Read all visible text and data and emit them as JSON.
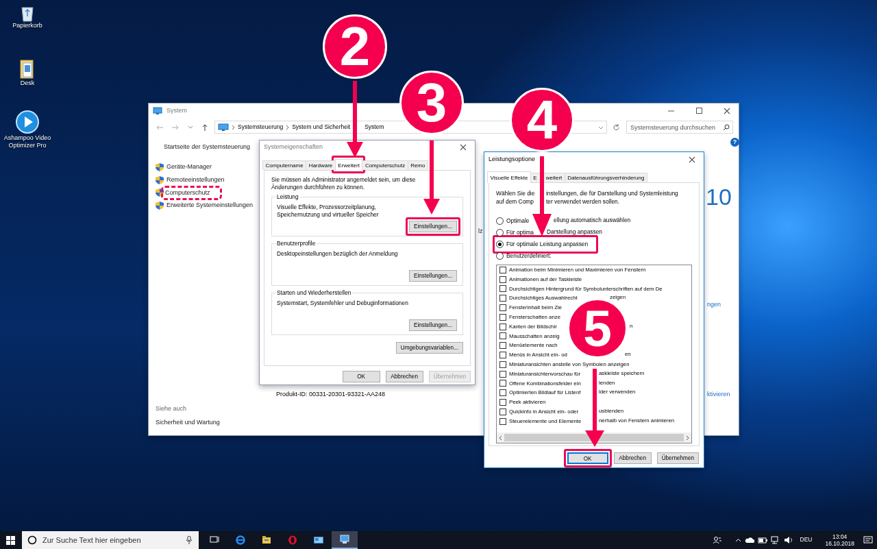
{
  "desktop_icons": [
    {
      "kind": "recycle-bin",
      "label": "Papierkorb"
    },
    {
      "kind": "folder",
      "label": "Desk"
    },
    {
      "kind": "player",
      "label": "Ashampoo Video Optimizer Pro"
    }
  ],
  "system_window": {
    "title": "System",
    "breadcrumb": [
      "Systemsteuerung",
      "System und Sicherheit",
      "System"
    ],
    "search": {
      "placeholder": "Systemsteuerung durchsuchen"
    },
    "help": "?",
    "home_link": "Startseite der Systemsteuerung",
    "links": [
      {
        "label": "Geräte-Manager",
        "highlighted": false
      },
      {
        "label": "Remoteeinstellungen",
        "highlighted": false
      },
      {
        "label": "Computerschutz",
        "highlighted": true,
        "dashed": true
      },
      {
        "label": "Erweiterte Systemeinstellungen",
        "highlighted": false
      }
    ],
    "see_also": {
      "title": "Siehe auch",
      "links": [
        "Sicherheit und Wartung"
      ]
    },
    "product_id": "Produkt-ID: 00331-20301-93321-AA248",
    "fragments": [
      "lz",
      "10",
      "ngen",
      "ktivieren"
    ]
  },
  "system_properties": {
    "title": "Systemeigenschaften",
    "tabs": [
      {
        "label": "Computername",
        "selected": false,
        "highlighted": false
      },
      {
        "label": "Hardware",
        "selected": false,
        "highlighted": false
      },
      {
        "label": "Erweitert",
        "selected": true,
        "highlighted": true
      },
      {
        "label": "Computerschutz",
        "selected": false,
        "highlighted": false
      },
      {
        "label": "Remo",
        "selected": false,
        "highlighted": false
      }
    ],
    "note": "Sie müssen als Administrator angemeldet sein, um diese Änderungen durchführen zu können.",
    "groups": [
      {
        "title": "Leistung",
        "text": "Visuelle Effekte, Prozessorzeitplanung, Speichernutzung und virtueller Speicher",
        "button": "Einstellungen...",
        "highlighted": true
      },
      {
        "title": "Benutzerprofile",
        "text": "Desktopeinstellungen bezüglich der Anmeldung",
        "button": "Einstellungen...",
        "highlighted": false
      },
      {
        "title": "Starten und Wiederherstellen",
        "text": "Systemstart, Systemfehler und Debuginformationen",
        "button": "Einstellungen...",
        "highlighted": false
      }
    ],
    "env_button": "Umgebungsvariablen...",
    "buttons": [
      {
        "label": "OK",
        "disabled": false
      },
      {
        "label": "Abbrechen",
        "disabled": false
      },
      {
        "label": "Übernehmen",
        "disabled": true
      }
    ]
  },
  "performance_options": {
    "title": "Leistungsoptione",
    "tabs": [
      {
        "label": [
          "Visuelle Effekte"
        ],
        "selected": true
      },
      {
        "label": [
          "E",
          "weitert"
        ],
        "selected": false
      },
      {
        "label": [
          "Datenausführungsverhinderung"
        ],
        "selected": false
      }
    ],
    "intro_lines": [
      [
        "Wählen Sie die",
        "instellungen, die für Darstellung und Systemleistung"
      ],
      [
        "auf dem Comp",
        "ter verwendet werden sollen."
      ]
    ],
    "radios": [
      {
        "label": [
          "Optimale",
          "ellung automatisch auswählen"
        ],
        "selected": false,
        "highlighted": false
      },
      {
        "label": [
          "Für optima",
          "Darstellung anpassen"
        ],
        "selected": false,
        "highlighted": false
      },
      {
        "label": [
          "Für optimale Leistung anpassen"
        ],
        "selected": true,
        "highlighted": true
      },
      {
        "label": [
          "Benutzerdefiniert:"
        ],
        "selected": false,
        "highlighted": false
      }
    ],
    "effects": [
      {
        "label": [
          "Animation beim Minimieren und Maximieren von Fenstern"
        ],
        "checked": false
      },
      {
        "label": [
          "Animationen auf der Taskleiste"
        ],
        "checked": false
      },
      {
        "label": [
          "Durchsichtigen Hintergrund für Symbolunterschriften auf dem De"
        ],
        "checked": false
      },
      {
        "label": [
          "Durchsichtiges Auswahlrecht",
          "zeigen"
        ],
        "checked": false
      },
      {
        "label": [
          "Fensterinhalt beim Zie"
        ],
        "checked": false
      },
      {
        "label": [
          "Fensterschatten anze"
        ],
        "checked": false
      },
      {
        "label": [
          "Kanten der Bildschir",
          "n"
        ],
        "checked": false
      },
      {
        "label": [
          "Mausschatten anzeig"
        ],
        "checked": false
      },
      {
        "label": [
          "Menüelemente nach"
        ],
        "checked": false
      },
      {
        "label": [
          "Menüs in Ansicht ein- od",
          "en"
        ],
        "checked": false
      },
      {
        "label": [
          "Miniaturansichten anstelle von Symbolen anzeigen"
        ],
        "checked": false
      },
      {
        "label": [
          "Miniaturansichtenvorschau für",
          "askleiste speichern"
        ],
        "checked": false
      },
      {
        "label": [
          "Offene Kombinationsfelder ein",
          "lenden"
        ],
        "checked": false
      },
      {
        "label": [
          "Optimierten Bildlauf für Listenf",
          "lder verwenden"
        ],
        "checked": false
      },
      {
        "label": [
          "Peek aktivieren"
        ],
        "checked": false
      },
      {
        "label": [
          "Quickinfo in Ansicht ein- oder",
          "usblenden"
        ],
        "checked": false
      },
      {
        "label": [
          "Steuerelemente und Elemente",
          "nerhalb von Fenstern animieren"
        ],
        "checked": false
      }
    ],
    "buttons": [
      {
        "label": "OK",
        "default": true,
        "highlighted": true
      },
      {
        "label": "Abbrechen",
        "default": false,
        "highlighted": false
      },
      {
        "label": "Übernehmen",
        "default": false,
        "highlighted": false
      }
    ]
  },
  "annotations": [
    {
      "number": "2"
    },
    {
      "number": "3"
    },
    {
      "number": "4"
    },
    {
      "number": "5"
    }
  ],
  "taskbar": {
    "search": {
      "placeholder": "Zur Suche Text hier eingeben"
    },
    "apps": [
      {
        "kind": "taskview",
        "selected": false
      },
      {
        "kind": "edge",
        "selected": false
      },
      {
        "kind": "explorer",
        "selected": false
      },
      {
        "kind": "opera",
        "selected": false
      },
      {
        "kind": "control-panel",
        "selected": false
      },
      {
        "kind": "system",
        "selected": true
      }
    ],
    "language": "DEU",
    "time": "13:04",
    "date": "16.10.2018"
  }
}
